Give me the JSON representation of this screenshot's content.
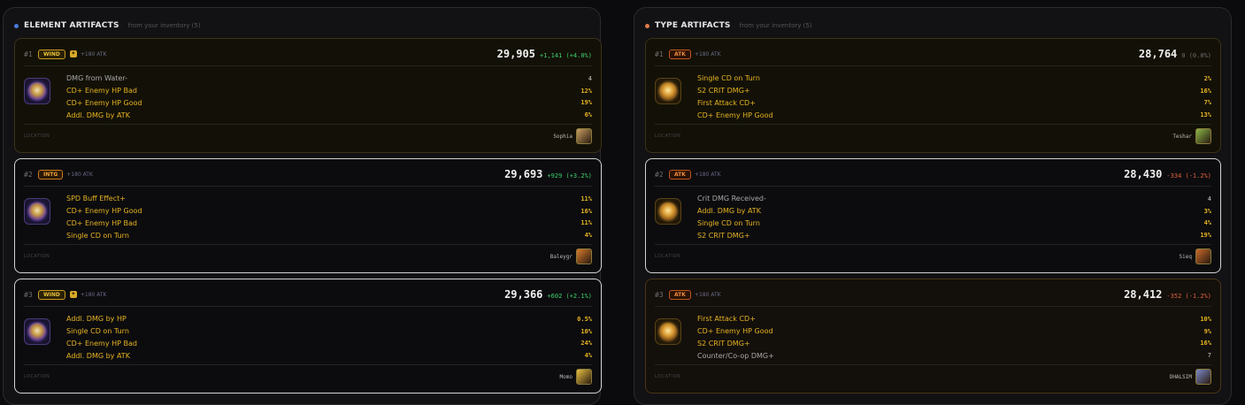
{
  "panels": [
    {
      "title": "ELEMENT ARTIFACTS",
      "subtitle": "from your inventory (5)",
      "accent": "#4a7bd8",
      "cards": [
        {
          "rank": "#1",
          "badge": "WIND",
          "badge_kind": "wind",
          "imprint": true,
          "atk": "+180 ATK",
          "score": "29,905",
          "delta": "+1,141 (+4.0%)",
          "delta_kind": "pos",
          "subs": [
            {
              "name": "DMG from Water-",
              "value": "4",
              "dim": true
            },
            {
              "name": "CD+ Enemy HP Bad",
              "value": "12%"
            },
            {
              "name": "CD+ Enemy HP Good",
              "value": "19%"
            },
            {
              "name": "Addl. DMG by ATK",
              "value": "6%"
            }
          ],
          "location": "LOCATION",
          "owner": "Sophia",
          "portrait_color": "#c8a060",
          "style": "gold"
        },
        {
          "rank": "#2",
          "badge": "INTG",
          "badge_kind": "intg",
          "imprint": false,
          "atk": "+180 ATK",
          "score": "29,693",
          "delta": "+929 (+3.2%)",
          "delta_kind": "pos",
          "subs": [
            {
              "name": "SPD Buff Effect+",
              "value": "11%"
            },
            {
              "name": "CD+ Enemy HP Good",
              "value": "16%"
            },
            {
              "name": "CD+ Enemy HP Bad",
              "value": "11%"
            },
            {
              "name": "Single CD on Turn",
              "value": "4%"
            }
          ],
          "location": "LOCATION",
          "owner": "Baleygr",
          "portrait_color": "#d87a2a",
          "style": "white"
        },
        {
          "rank": "#3",
          "badge": "WIND",
          "badge_kind": "wind",
          "imprint": true,
          "atk": "+180 ATK",
          "score": "29,366",
          "delta": "+602 (+2.1%)",
          "delta_kind": "pos",
          "subs": [
            {
              "name": "Addl. DMG by HP",
              "value": "0.5%"
            },
            {
              "name": "Single CD on Turn",
              "value": "10%"
            },
            {
              "name": "CD+ Enemy HP Bad",
              "value": "24%"
            },
            {
              "name": "Addl. DMG by ATK",
              "value": "4%"
            }
          ],
          "location": "LOCATION",
          "owner": "Momo",
          "portrait_color": "#e8c040",
          "style": "white"
        }
      ]
    },
    {
      "title": "TYPE ARTIFACTS",
      "subtitle": "from your inventory (5)",
      "accent": "#e07a4a",
      "cards": [
        {
          "rank": "#1",
          "badge": "ATK",
          "badge_kind": "atk",
          "imprint": false,
          "atk": "+180 ATK",
          "score": "28,764",
          "delta": "0 (0.0%)",
          "delta_kind": "zero",
          "subs": [
            {
              "name": "Single CD on Turn",
              "value": "2%"
            },
            {
              "name": "S2 CRIT DMG+",
              "value": "16%"
            },
            {
              "name": "First Attack CD+",
              "value": "7%"
            },
            {
              "name": "CD+ Enemy HP Good",
              "value": "13%"
            }
          ],
          "location": "LOCATION",
          "owner": "Teshar",
          "portrait_color": "#8ab848",
          "style": "gold"
        },
        {
          "rank": "#2",
          "badge": "ATK",
          "badge_kind": "atk",
          "imprint": false,
          "atk": "+180 ATK",
          "score": "28,430",
          "delta": "-334 (-1.2%)",
          "delta_kind": "neg",
          "subs": [
            {
              "name": "Crit DMG Received-",
              "value": "4",
              "dim": true
            },
            {
              "name": "Addl. DMG by ATK",
              "value": "3%"
            },
            {
              "name": "Single CD on Turn",
              "value": "4%"
            },
            {
              "name": "S2 CRIT DMG+",
              "value": "19%"
            }
          ],
          "location": "LOCATION",
          "owner": "Sieq",
          "portrait_color": "#c86a2a",
          "style": "white"
        },
        {
          "rank": "#3",
          "badge": "ATK",
          "badge_kind": "atk",
          "imprint": false,
          "atk": "+180 ATK",
          "score": "28,412",
          "delta": "-352 (-1.2%)",
          "delta_kind": "neg",
          "subs": [
            {
              "name": "First Attack CD+",
              "value": "10%"
            },
            {
              "name": "CD+ Enemy HP Good",
              "value": "9%"
            },
            {
              "name": "S2 CRIT DMG+",
              "value": "16%"
            },
            {
              "name": "Counter/Co-op DMG+",
              "value": "7",
              "dim": true
            }
          ],
          "location": "LOCATION",
          "owner": "DHALSIM",
          "portrait_color": "#7a8ac8",
          "style": "brown"
        }
      ]
    }
  ]
}
